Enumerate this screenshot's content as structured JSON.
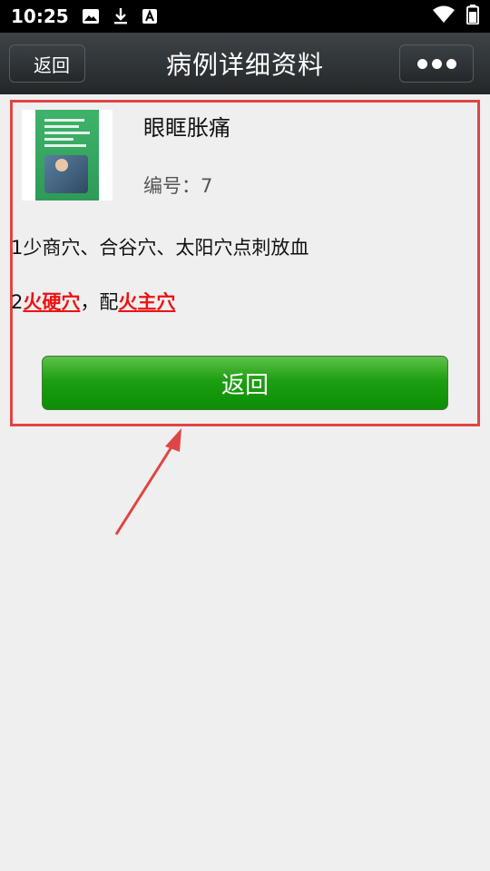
{
  "status_bar": {
    "time": "10:25",
    "icons": [
      "image-icon",
      "download-icon",
      "keyboard-a-icon",
      "wifi-icon",
      "battery-icon"
    ]
  },
  "header": {
    "back_label": "返回",
    "title": "病例详细资料",
    "more_icon": "more-dots-icon"
  },
  "case": {
    "title": "眼眶胀痛",
    "number_label": "编号：",
    "number_value": "7",
    "thumbnail_icon": "book-cover-icon"
  },
  "content": {
    "line1": "1少商穴、合谷穴、太阳穴点刺放血",
    "line2_prefix": "2",
    "line2_point1": "火硬穴",
    "line2_sep": "，配",
    "line2_point2": "火主穴"
  },
  "actions": {
    "return_label": "返回"
  },
  "colors": {
    "highlight_border": "#e04545",
    "point_text": "#ee1111",
    "button_green": "#0c8e05"
  }
}
